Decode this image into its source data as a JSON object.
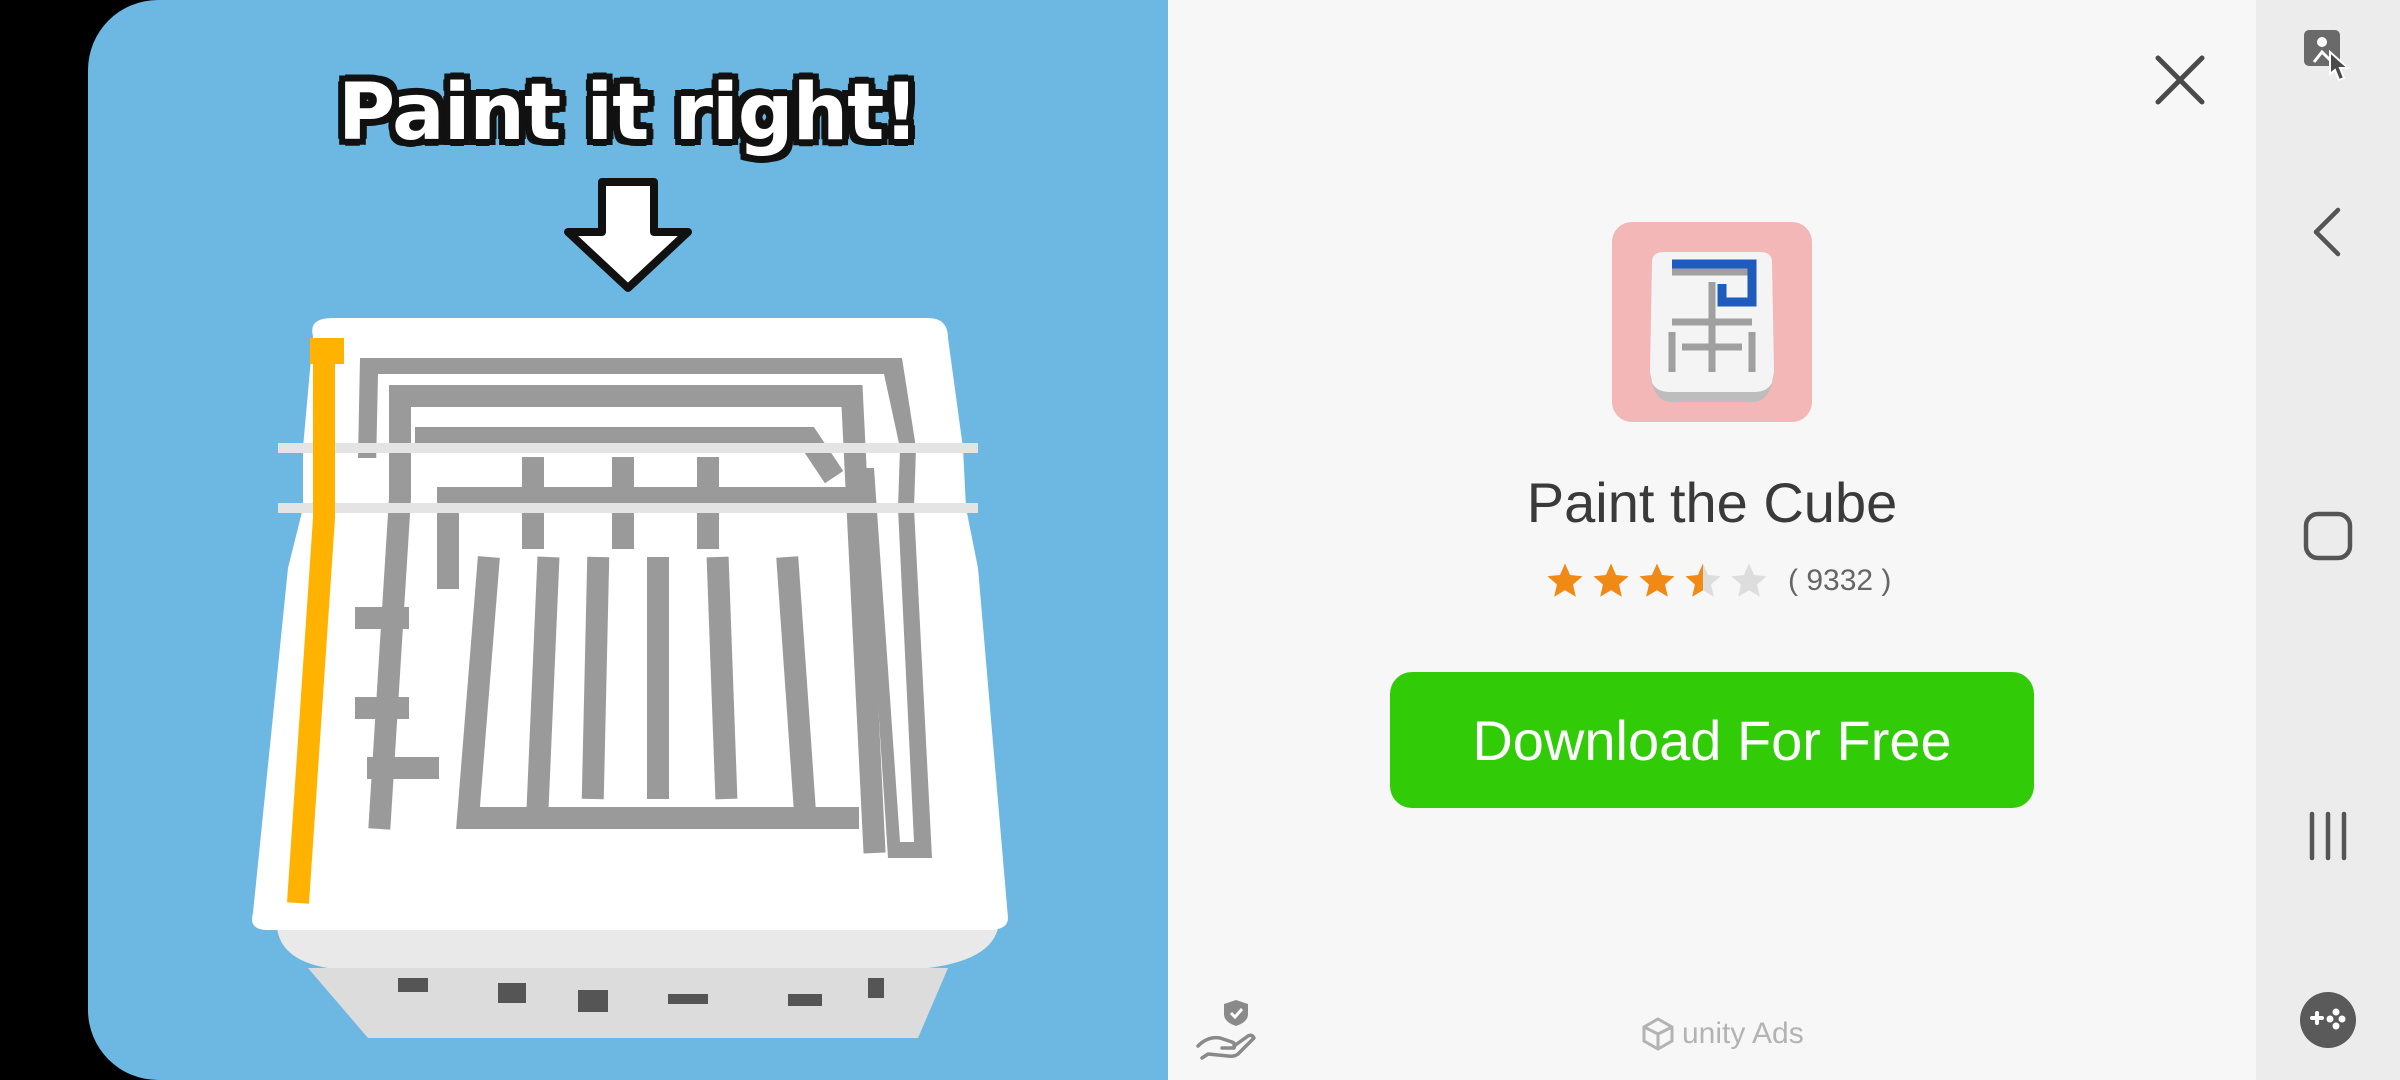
{
  "creative": {
    "headline": "Paint it right!"
  },
  "ad": {
    "app_name": "Paint the Cube",
    "rating": 3.5,
    "rating_max": 5,
    "rating_count": "( 9332 )",
    "download_label": "Download For Free",
    "network_label": "unity Ads",
    "close_icon": "close-icon",
    "privacy_icon": "privacy-hand-shield-icon"
  },
  "navbar": {
    "items": [
      "screen-touch-icon",
      "back-icon",
      "home-icon",
      "recents-icon",
      "game-tools-icon"
    ]
  },
  "colors": {
    "creative_bg": "#6cb8e2",
    "panel_bg": "#f7f7f7",
    "download_button": "#31cc07",
    "star_filled": "#f08a14",
    "star_empty": "#dddddd",
    "paint_yellow": "#ffb300"
  }
}
